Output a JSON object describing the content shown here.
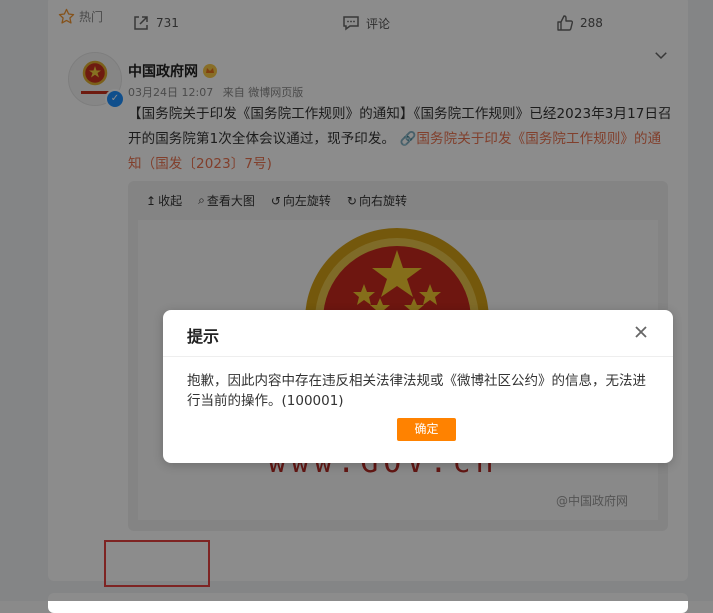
{
  "hot_label": "热门",
  "post": {
    "username": "中国政府网",
    "date": "03月24日 12:07",
    "source": "来自 微博网页版",
    "text_main": "【国务院关于印发《国务院工作规则》的通知】《国务院工作规则》已经2023年3月17日召开的国务院第1次全体会议通过，现予印发。",
    "text_link": "国务院关于印发《国务院工作规则》的通知（国发〔2023〕7号)"
  },
  "media_toolbar": {
    "collapse": "收起",
    "view_large": "查看大图",
    "rotate_left": "向左旋转",
    "rotate_right": "向右旋转"
  },
  "image": {
    "gov_text": "www.GOV.cn",
    "watermark": "@中国政府网"
  },
  "actions": {
    "forward_count": "731",
    "comment_label": "评论",
    "like_count": "288"
  },
  "modal": {
    "title": "提示",
    "message": "抱歉，因此内容中存在违反相关法律法规或《微博社区公约》的信息，无法进行当前的操作。(100001)",
    "confirm": "确定"
  },
  "colors": {
    "link": "#eb7350",
    "confirm_button": "#ff8200",
    "highlight_box": "#e64340",
    "verified": "#1e90ff"
  }
}
